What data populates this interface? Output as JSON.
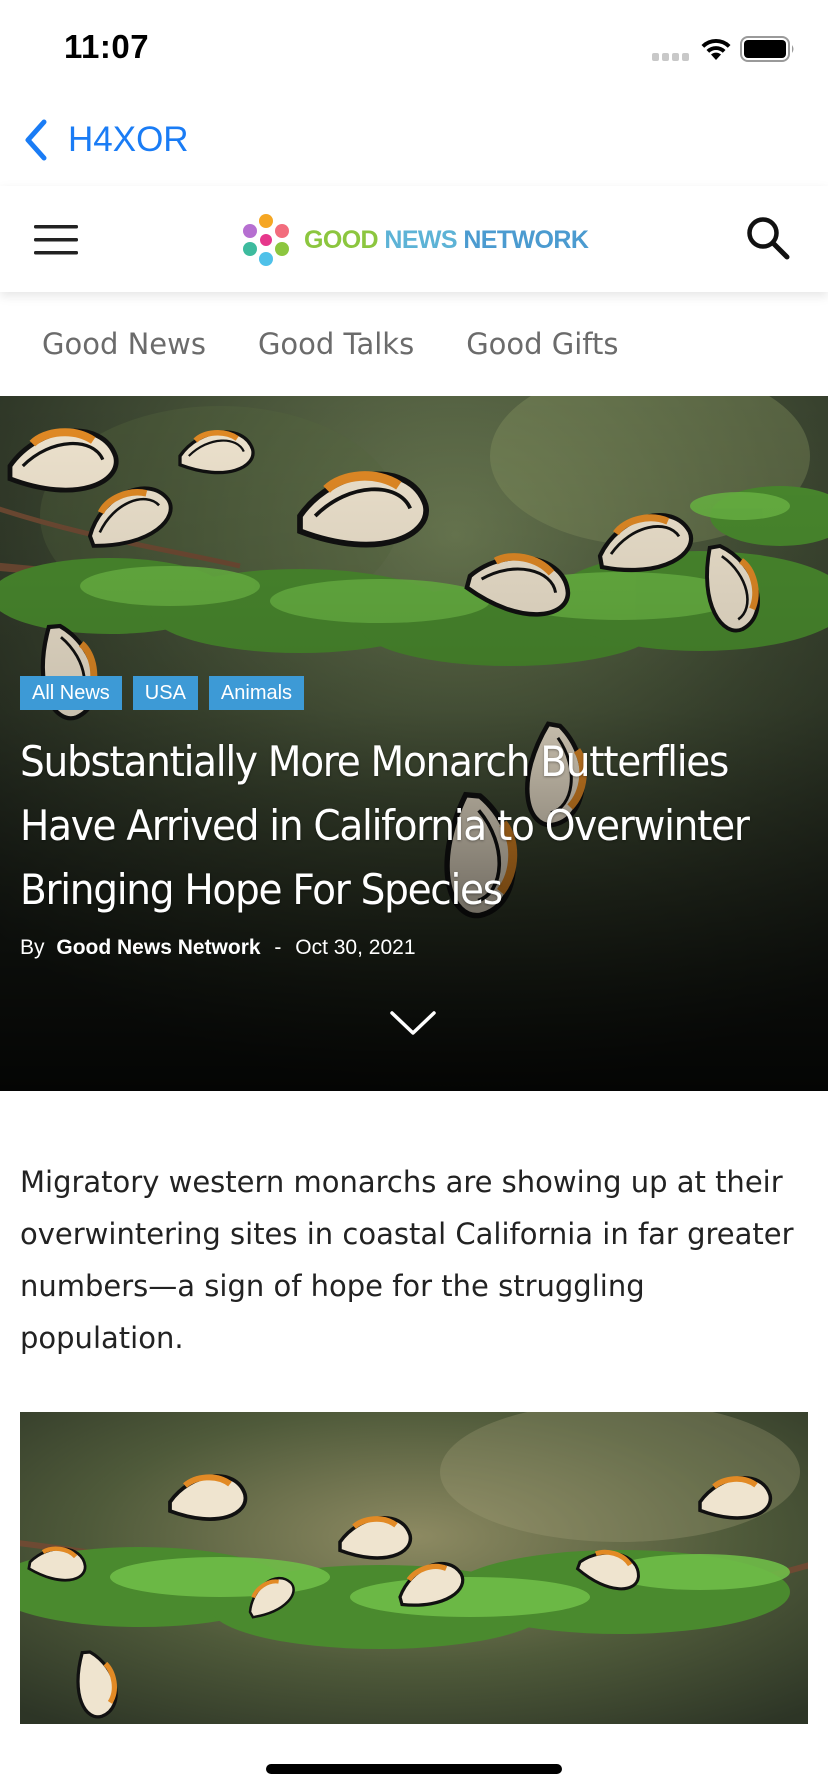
{
  "status_bar": {
    "time": "11:07"
  },
  "nav": {
    "back_label": "H4XOR"
  },
  "header": {
    "logo_words": [
      "GOOD",
      "NEWS",
      "NETWORK"
    ],
    "icons": [
      "menu-icon",
      "logo-icon",
      "search-icon"
    ]
  },
  "categories": [
    "Good News",
    "Good Talks",
    "Good Gifts"
  ],
  "hero": {
    "tags": [
      "All News",
      "USA",
      "Animals"
    ],
    "title": "Substantially More Monarch Butterflies Have Arrived in California to Overwinter Bringing Hope For Species",
    "by_label": "By",
    "author": "Good News Network",
    "separator": "-",
    "date": "Oct 30, 2021"
  },
  "article": {
    "lead": "Migratory western monarchs are showing up at their overwintering sites in coastal California in far greater numbers—a sign of hope for the struggling population."
  },
  "colors": {
    "link_blue": "#1a7cf5",
    "tag_blue": "#3d9ad6",
    "logo_green": "#8cc63f",
    "logo_blue": "#4b9bd0"
  }
}
